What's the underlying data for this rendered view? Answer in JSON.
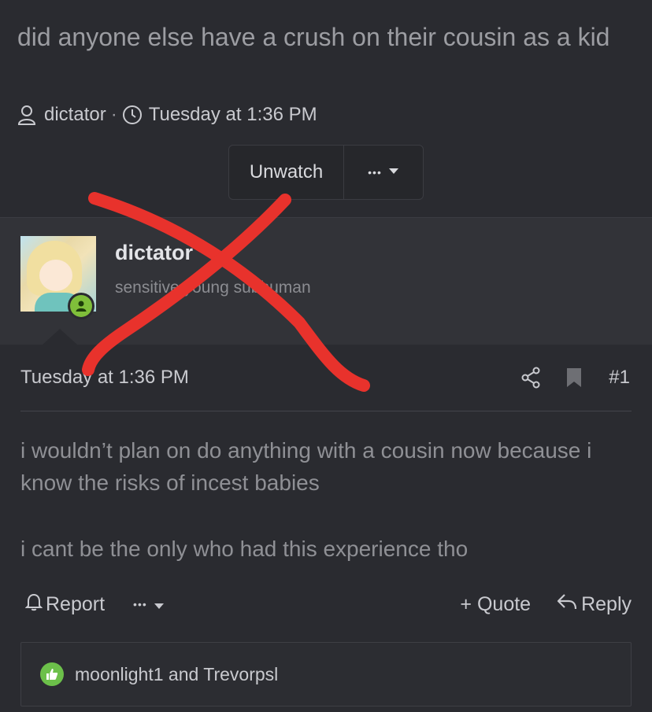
{
  "thread": {
    "title": "did anyone else have a crush on their cousin as a kid",
    "author": "dictator",
    "separator": "·",
    "timestamp": "Tuesday at 1:36 PM",
    "unwatch_label": "Unwatch",
    "more_label": "•••"
  },
  "post": {
    "username": "dictator",
    "user_title": "sensitive young subhuman",
    "date": "Tuesday at 1:36 PM",
    "post_number": "#1",
    "body": [
      "i wouldn’t plan on do anything with a cousin now because i know the risks of incest babies",
      "i cant be the only who had this experience tho"
    ],
    "actions": {
      "report_label": "Report",
      "more_label": "•••",
      "quote_label": "+ Quote",
      "reply_label": "Reply"
    },
    "reactions_text": "moonlight1 and Trevorpsl"
  },
  "colors": {
    "background": "#2a2b30",
    "user_block": "#323338",
    "online_green": "#7fbf3a",
    "like_green": "#6cc04a",
    "overlay_red": "#e8322c"
  },
  "icons": [
    "user-icon",
    "clock-icon",
    "caret-down-icon",
    "share-icon",
    "bookmark-icon",
    "bell-icon",
    "reply-icon",
    "thumbs-up-icon",
    "red-x-overlay"
  ]
}
